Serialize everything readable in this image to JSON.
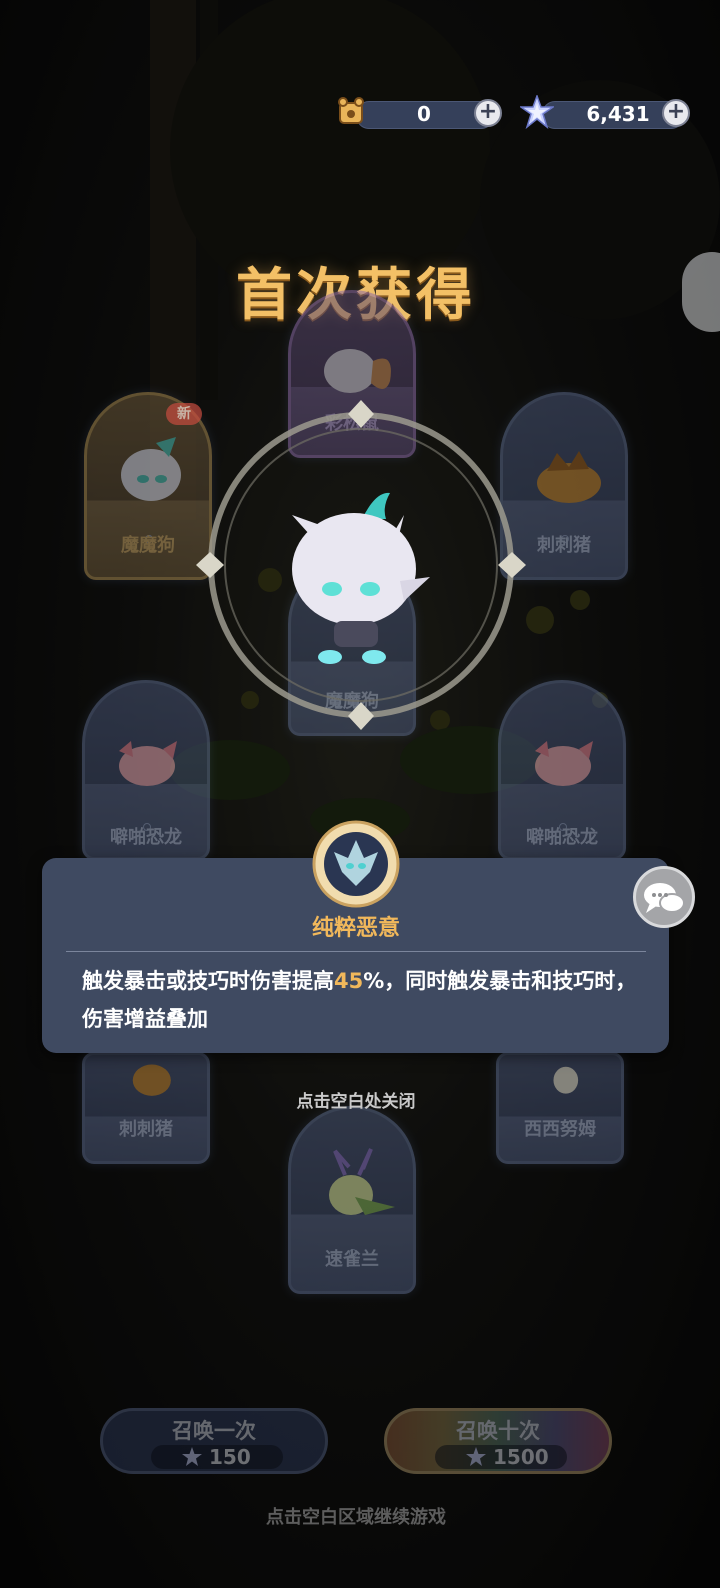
{
  "currency": {
    "tickets": {
      "icon": "scroll-ticket-icon",
      "value": "0"
    },
    "gems": {
      "icon": "star-crystal-icon",
      "value": "6,431"
    },
    "plus_label": "+"
  },
  "title": "首次获得",
  "cards": {
    "top": {
      "name": "彩松鼠"
    },
    "left_upper": {
      "name": "魔魔狗",
      "badge": "新"
    },
    "right_upper": {
      "name": "刺刺猪"
    },
    "center_lower": {
      "name": "魔魔狗"
    },
    "left_middle": {
      "name": "噼啪恐龙"
    },
    "right_middle": {
      "name": "噼啪恐龙"
    },
    "left_bottom": {
      "name": "刺刺猪"
    },
    "right_bottom": {
      "name": "西西努姆"
    },
    "bottom": {
      "name": "速雀兰"
    }
  },
  "skill": {
    "name": "纯粹恶意",
    "desc_before": "触发暴击或技巧时伤害提高",
    "desc_highlight": "45",
    "desc_after": "%，同时触发暴击和技巧时，伤害增益叠加"
  },
  "hint_close": "点击空白处关闭",
  "summon": {
    "one": {
      "label": "召唤一次",
      "cost": "150"
    },
    "ten": {
      "label": "召唤十次",
      "cost": "1500"
    }
  },
  "hint_continue": "点击空白区域继续游戏",
  "colors": {
    "accent_gold": "#f1b85b",
    "panel_bg": "#3f4a61"
  }
}
